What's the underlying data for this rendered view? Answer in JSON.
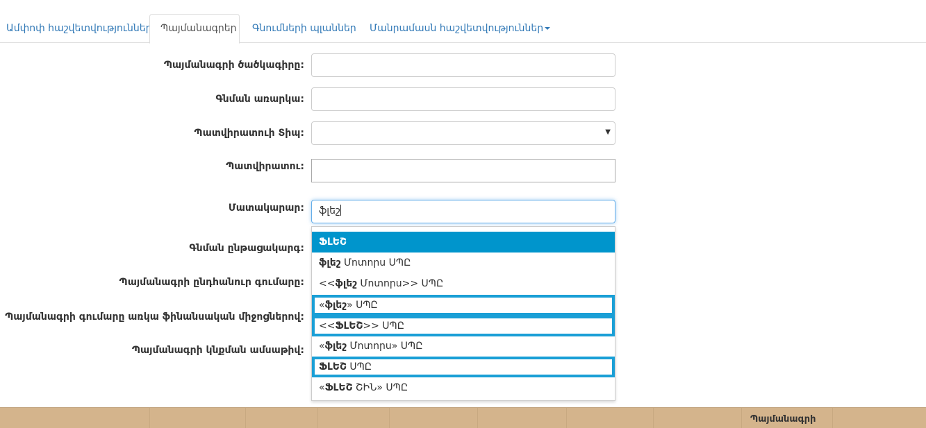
{
  "tabs": [
    {
      "label": "Ամփոփ հաշվետվություններ"
    },
    {
      "label": "Պայմանագրեր"
    },
    {
      "label": "Գնումների պլաններ"
    },
    {
      "label": "Մանրամասն հաշվետվություններ"
    }
  ],
  "form": {
    "contract_code_label": "Պայմանագրի ծածկագիրը:",
    "contract_code_value": "",
    "subject_label": "Գնման առարկա:",
    "subject_value": "",
    "customer_type_label": "Պատվիրատուի Տիպ:",
    "customer_type_value": "",
    "customer_label": "Պատվիրատու:",
    "customer_value": "",
    "supplier_label": "Մատակարար:",
    "supplier_value": "ֆլեշ",
    "procedure_label": "Գնման ընթացակարգ:",
    "total_amount_label": "Պայմանագրի ընդհանուր գումարը:",
    "financial_label": "Պայմանագրի գումարը առկա ֆինանսական միջոցներով:",
    "sign_date_label": "Պայմանագրի կնքման ամսաթիվ:"
  },
  "suggestions": [
    {
      "pre": "",
      "bold": "ՖԼԵՇ",
      "post": "",
      "state": "selected"
    },
    {
      "pre": "",
      "bold": "ֆլեշ",
      "post": " Մոտորս ՍՊԸ",
      "state": "normal"
    },
    {
      "pre": "<<",
      "bold": "ֆլեշ",
      "post": " Մոտորս>> ՍՊԸ",
      "state": "normal"
    },
    {
      "pre": "«",
      "bold": "ֆլեշ",
      "post": "» ՍՊԸ",
      "state": "outlined"
    },
    {
      "pre": "<<",
      "bold": "ՖԼԵՇ",
      "post": ">> ՍՊԸ",
      "state": "outlined"
    },
    {
      "pre": "«",
      "bold": "ֆլեշ",
      "post": " Մոտորս» ՍՊԸ",
      "state": "normal"
    },
    {
      "pre": "",
      "bold": "ՖԼԵՇ",
      "post": " ՍՊԸ",
      "state": "outlined"
    },
    {
      "pre": "«",
      "bold": "ՖԼԵՇ",
      "post": " ՇԻՆ» ՍՊԸ",
      "state": "normal"
    }
  ],
  "table": {
    "header_contract": "Պայմանագրի"
  },
  "colors": {
    "tab_link": "#337ab7",
    "selected_bg": "#0095cc",
    "highlight_border": "#1a9fd6",
    "table_header_bg": "#d4b48c"
  },
  "icons": {
    "dropdown_caret": "caret-down-icon",
    "select_arrow": "select-arrow-icon"
  }
}
